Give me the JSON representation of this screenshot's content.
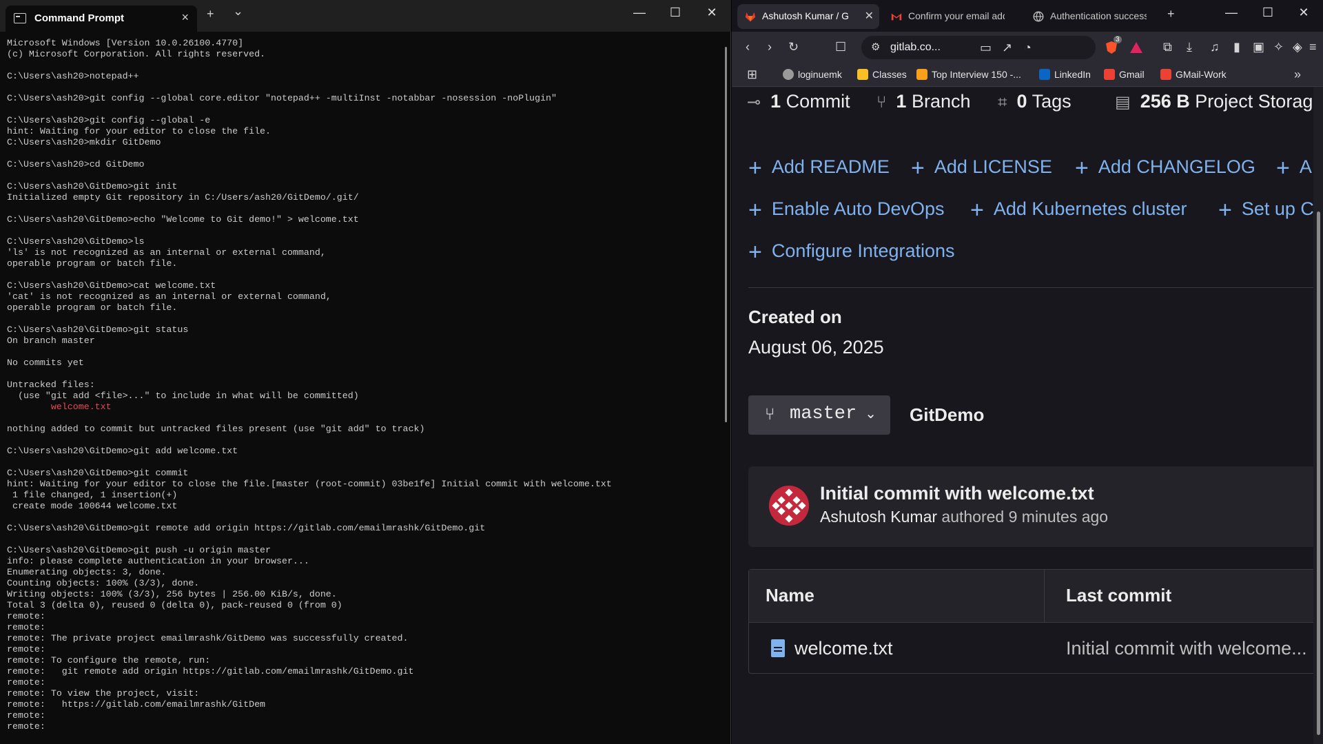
{
  "cmd": {
    "tab_title": "Command Prompt",
    "new_tab": "+",
    "dropdown": "⌄",
    "lines": [
      {
        "t": "Microsoft Windows [Version 10.0.26100.4770]"
      },
      {
        "t": "(c) Microsoft Corporation. All rights reserved."
      },
      {
        "t": ""
      },
      {
        "t": "C:\\Users\\ash20>notepad++"
      },
      {
        "t": ""
      },
      {
        "t": "C:\\Users\\ash20>git config --global core.editor \"notepad++ -multiInst -notabbar -nosession -noPlugin\""
      },
      {
        "t": ""
      },
      {
        "t": "C:\\Users\\ash20>git config --global -e"
      },
      {
        "t": "hint: Waiting for your editor to close the file."
      },
      {
        "t": "C:\\Users\\ash20>mkdir GitDemo"
      },
      {
        "t": ""
      },
      {
        "t": "C:\\Users\\ash20>cd GitDemo"
      },
      {
        "t": ""
      },
      {
        "t": "C:\\Users\\ash20\\GitDemo>git init"
      },
      {
        "t": "Initialized empty Git repository in C:/Users/ash20/GitDemo/.git/"
      },
      {
        "t": ""
      },
      {
        "t": "C:\\Users\\ash20\\GitDemo>echo \"Welcome to Git demo!\" > welcome.txt"
      },
      {
        "t": ""
      },
      {
        "t": "C:\\Users\\ash20\\GitDemo>ls"
      },
      {
        "t": "'ls' is not recognized as an internal or external command,"
      },
      {
        "t": "operable program or batch file."
      },
      {
        "t": ""
      },
      {
        "t": "C:\\Users\\ash20\\GitDemo>cat welcome.txt"
      },
      {
        "t": "'cat' is not recognized as an internal or external command,"
      },
      {
        "t": "operable program or batch file."
      },
      {
        "t": ""
      },
      {
        "t": "C:\\Users\\ash20\\GitDemo>git status"
      },
      {
        "t": "On branch master"
      },
      {
        "t": ""
      },
      {
        "t": "No commits yet"
      },
      {
        "t": ""
      },
      {
        "t": "Untracked files:"
      },
      {
        "t": "  (use \"git add <file>...\" to include in what will be committed)"
      },
      {
        "t": "        welcome.txt",
        "red": true
      },
      {
        "t": ""
      },
      {
        "t": "nothing added to commit but untracked files present (use \"git add\" to track)"
      },
      {
        "t": ""
      },
      {
        "t": "C:\\Users\\ash20\\GitDemo>git add welcome.txt"
      },
      {
        "t": ""
      },
      {
        "t": "C:\\Users\\ash20\\GitDemo>git commit"
      },
      {
        "t": "hint: Waiting for your editor to close the file.[master (root-commit) 03be1fe] Initial commit with welcome.txt"
      },
      {
        "t": " 1 file changed, 1 insertion(+)"
      },
      {
        "t": " create mode 100644 welcome.txt"
      },
      {
        "t": ""
      },
      {
        "t": "C:\\Users\\ash20\\GitDemo>git remote add origin https://gitlab.com/emailmrashk/GitDemo.git"
      },
      {
        "t": ""
      },
      {
        "t": "C:\\Users\\ash20\\GitDemo>git push -u origin master"
      },
      {
        "t": "info: please complete authentication in your browser..."
      },
      {
        "t": "Enumerating objects: 3, done."
      },
      {
        "t": "Counting objects: 100% (3/3), done."
      },
      {
        "t": "Writing objects: 100% (3/3), 256 bytes | 256.00 KiB/s, done."
      },
      {
        "t": "Total 3 (delta 0), reused 0 (delta 0), pack-reused 0 (from 0)"
      },
      {
        "t": "remote:"
      },
      {
        "t": "remote:"
      },
      {
        "t": "remote: The private project emailmrashk/GitDemo was successfully created."
      },
      {
        "t": "remote:"
      },
      {
        "t": "remote: To configure the remote, run:"
      },
      {
        "t": "remote:   git remote add origin https://gitlab.com/emailmrashk/GitDemo.git"
      },
      {
        "t": "remote:"
      },
      {
        "t": "remote: To view the project, visit:"
      },
      {
        "t": "remote:   https://gitlab.com/emailmrashk/GitDem"
      },
      {
        "t": "remote:"
      },
      {
        "t": "remote:"
      }
    ]
  },
  "browser": {
    "tabs": [
      {
        "label": "Ashutosh Kumar / G",
        "icon": "gitlab-icon"
      },
      {
        "label": "Confirm your email addr",
        "icon": "gmail-icon"
      },
      {
        "label": "Authentication successful",
        "icon": "globe-icon"
      }
    ],
    "address": "gitlab.co...",
    "shield_count": "3",
    "bookmarks": [
      {
        "label": "loginuemk",
        "icon": "globe-icon"
      },
      {
        "label": "Classes",
        "icon": "classroom-icon"
      },
      {
        "label": "Top Interview 150 -...",
        "icon": "leetcode-icon"
      },
      {
        "label": "LinkedIn",
        "icon": "linkedin-icon"
      },
      {
        "label": "Gmail",
        "icon": "gmail-icon"
      },
      {
        "label": "GMail-Work",
        "icon": "gmail-icon"
      }
    ]
  },
  "project": {
    "stats": {
      "commits_count": "1",
      "commits_label": "Commit",
      "branches_count": "1",
      "branches_label": "Branch",
      "tags_count": "0",
      "tags_label": "Tags",
      "storage_size": "256 B",
      "storage_label": "Project Storage"
    },
    "actions": {
      "add_readme": "Add README",
      "add_license": "Add LICENSE",
      "add_changelog": "Add CHANGELOG",
      "add_cut": "A",
      "enable_auto_devops": "Enable Auto DevOps",
      "add_kubernetes": "Add Kubernetes cluster",
      "set_up": "Set up C",
      "configure_integrations": "Configure Integrations"
    },
    "created_label": "Created on",
    "created_date": "August 06, 2025",
    "branch": "master",
    "repo_name": "GitDemo",
    "commit": {
      "title": "Initial commit with welcome.txt",
      "author": "Ashutosh Kumar",
      "meta": " authored 9 minutes ago"
    },
    "table": {
      "col_name": "Name",
      "col_last_commit": "Last commit",
      "rows": [
        {
          "name": "welcome.txt",
          "last_commit": "Initial commit with welcome..."
        }
      ]
    }
  },
  "colors": {
    "terminal_bg": "#0c0c0c",
    "terminal_text": "#cccccc",
    "terminal_red": "#e74856",
    "page_bg": "#18171d",
    "link_blue": "#7fb2ee"
  }
}
